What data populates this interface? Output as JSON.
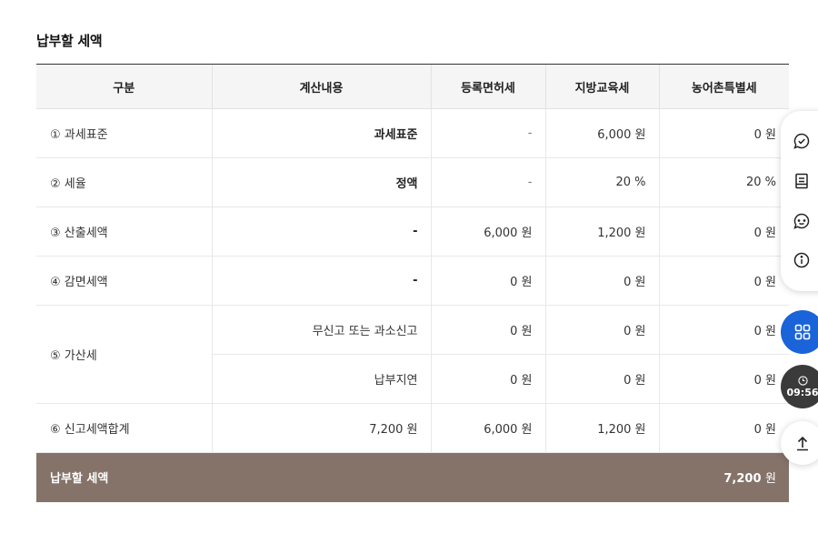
{
  "section": {
    "title": "납부할 세액"
  },
  "table": {
    "headers": [
      "구분",
      "계산내용",
      "등록면허세",
      "지방교육세",
      "농어촌특별세"
    ],
    "rows": [
      {
        "label": "① 과세표준",
        "calc": "과세표준",
        "registration": "-",
        "education": "6,000 원",
        "rural": "0 원"
      },
      {
        "label": "② 세율",
        "calc": "정액",
        "registration": "-",
        "education": "20 %",
        "rural": "20 %"
      },
      {
        "label": "③ 산출세액",
        "calc": "-",
        "registration": "6,000 원",
        "education": "1,200 원",
        "rural": "0 원"
      },
      {
        "label": "④ 감면세액",
        "calc": "-",
        "registration": "0 원",
        "education": "0 원",
        "rural": "0 원"
      }
    ],
    "penalty": {
      "label": "⑤ 가산세",
      "sub": [
        {
          "calc": "무신고 또는 과소신고",
          "registration": "0 원",
          "education": "0 원",
          "rural": "0 원"
        },
        {
          "calc": "납부지연",
          "registration": "0 원",
          "education": "0 원",
          "rural": "0 원"
        }
      ]
    },
    "total_row": {
      "label": "⑥ 신고세액합계",
      "calc": "7,200 원",
      "registration": "6,000 원",
      "education": "1,200 원",
      "rural": "0 원"
    },
    "footer": {
      "label": "납부할 세액",
      "amount": "7,200",
      "unit": "원"
    }
  },
  "quick_menu": {
    "items": [
      {
        "icon": "chat-check-icon"
      },
      {
        "icon": "document-icon"
      },
      {
        "icon": "chatbot-icon"
      },
      {
        "icon": "info-icon"
      }
    ],
    "menu_icon": "grid-menu-icon",
    "timer": {
      "icon": "clock-icon",
      "time": "09:56"
    },
    "top_icon": "arrow-up-icon"
  },
  "colors": {
    "footer_bg": "#857369",
    "menu_btn": "#1a63d8",
    "timer_btn": "#3a3a3a"
  }
}
